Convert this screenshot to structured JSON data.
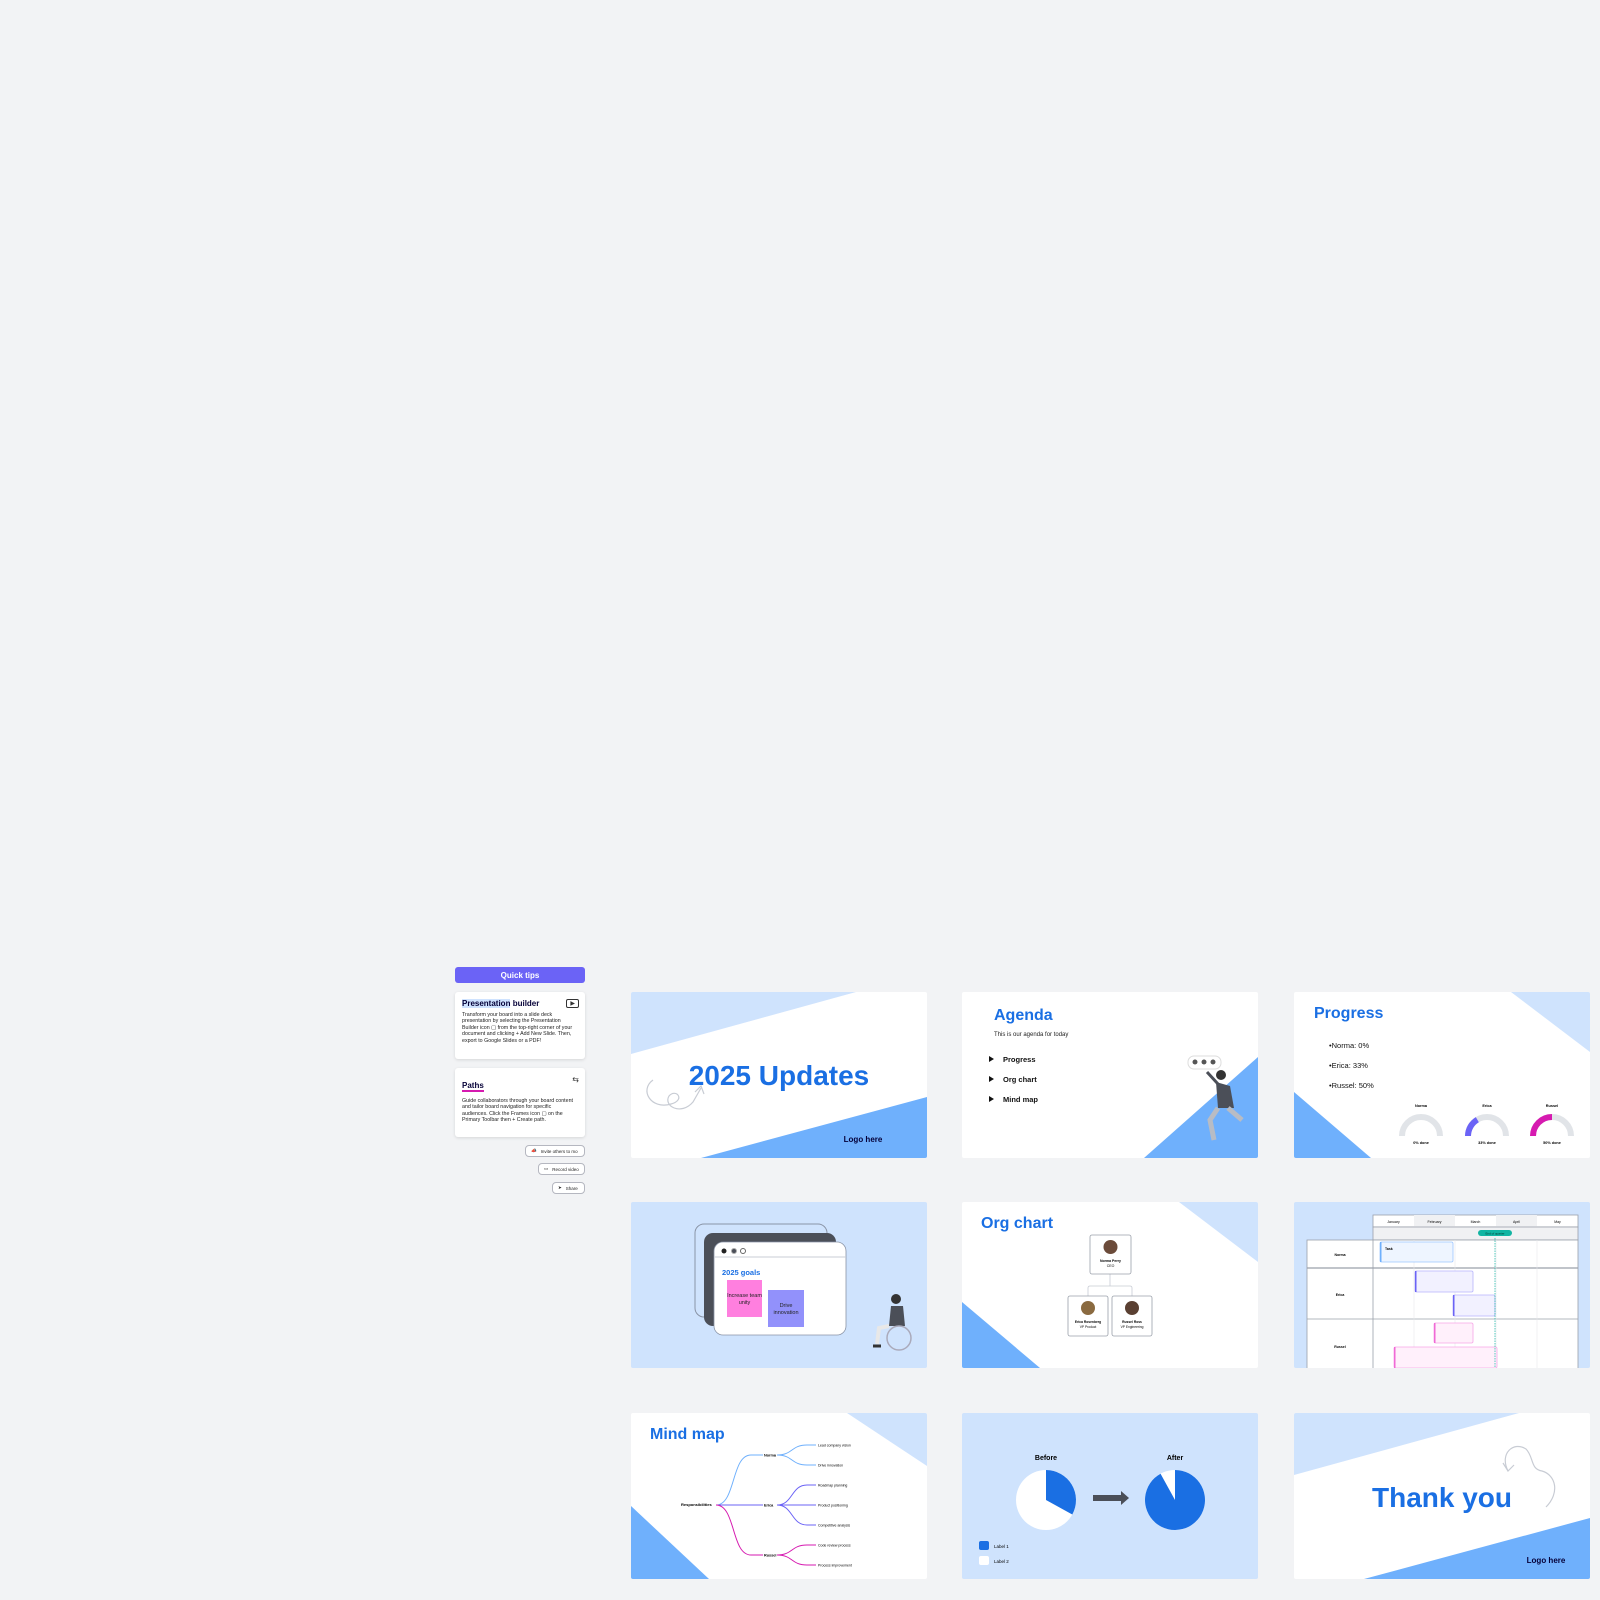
{
  "colors": {
    "accent": "#1a6fe3",
    "light_blue": "#cfe3fd",
    "mid_blue": "#6fb0fc",
    "purple": "#6b63f6",
    "magenta": "#d61ab0",
    "teal": "#12b5a3",
    "canvas": "#f2f3f5"
  },
  "quick_tips": {
    "title": "Quick tips",
    "cards": [
      {
        "title_highlight": "Presentation",
        "title_rest": " builder",
        "icon": "play-icon",
        "body": "Transform your board into a slide deck presentation by selecting the Presentation Builder icon ▢ from the top-right corner of your document and clicking + Add New Slide. Then, export to Google Slides or a PDF!"
      },
      {
        "title": "Paths",
        "icon": "path-icon",
        "body": "Guide collaborators through your board content and tailor board navigation for specific audiences. Click the Frames icon ▢ on the Primary Toolbar then + Create path."
      }
    ],
    "buttons": [
      {
        "label": "Invite others to mo",
        "icon": "megaphone-icon"
      },
      {
        "label": "Record video",
        "icon": "video-icon"
      },
      {
        "label": "Share",
        "icon": "send-icon"
      }
    ]
  },
  "slides": {
    "title_slide": {
      "title": "2025 Updates",
      "logo": "Logo here"
    },
    "agenda": {
      "title": "Agenda",
      "subtitle": "This is our agenda for today",
      "items": [
        "Progress",
        "Org chart",
        "Mind map"
      ]
    },
    "progress": {
      "title": "Progress",
      "bullets": [
        "Norma: 0%",
        "Erica: 33%",
        "Russel: 50%"
      ],
      "gauges": [
        {
          "name": "Norma",
          "value": 0,
          "label": "0% done",
          "color": "#6b63f6"
        },
        {
          "name": "Erica",
          "value": 33,
          "label": "33% done",
          "color": "#6b63f6"
        },
        {
          "name": "Russel",
          "value": 50,
          "label": "50% done",
          "color": "#d61ab0"
        }
      ]
    },
    "goals": {
      "title": "2025 goals",
      "stickies": [
        "Increase team unity",
        "Drive innovation"
      ]
    },
    "org_chart": {
      "title": "Org chart",
      "people": [
        {
          "name": "Norma Perry",
          "role": "CEO"
        },
        {
          "name": "Erica Rosenberg",
          "role": "VP Product"
        },
        {
          "name": "Russel Ross",
          "role": "VP Engineering"
        }
      ]
    },
    "timeline": {
      "months": [
        "January",
        "February",
        "March",
        "April",
        "May"
      ],
      "marker": "End of quarter",
      "rows": [
        "Norma",
        "Erica",
        "Russel"
      ],
      "task_label": "Task"
    },
    "mind_map": {
      "title": "Mind map",
      "root": "Responsibilities",
      "branches": [
        {
          "name": "Norma",
          "color": "#6fb0fc",
          "leaves": [
            "Lead company vision",
            "Drive innovation"
          ]
        },
        {
          "name": "Erica",
          "color": "#6b63f6",
          "leaves": [
            "Roadmap planning",
            "Product positioning",
            "Competitive analysis"
          ]
        },
        {
          "name": "Russel",
          "color": "#d61ab0",
          "leaves": [
            "Code review process",
            "Process improvement"
          ]
        }
      ]
    },
    "before_after": {
      "before": "Before",
      "after": "After",
      "legend": [
        "Label 1",
        "Label 2"
      ],
      "before_pct": 33,
      "after_pct": 92
    },
    "thank_you": {
      "title": "Thank you",
      "logo": "Logo here"
    }
  }
}
